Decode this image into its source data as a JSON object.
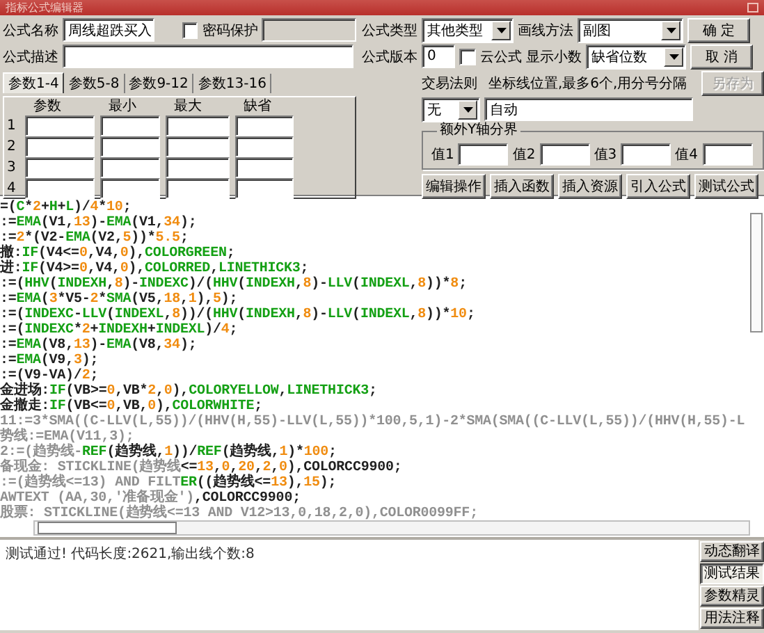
{
  "window": {
    "title": "指标公式编辑器"
  },
  "formula": {
    "name_label": "公式名称",
    "name": "周线超跌买入",
    "password": {
      "label": "密码保护",
      "checked": false
    },
    "desc_label": "公式描述",
    "type_label": "公式类型",
    "type": "其他类型",
    "draw_label": "画线方法",
    "draw": "副图",
    "version_label": "公式版本",
    "version": "0",
    "cloud": {
      "label": "云公式",
      "checked": false
    },
    "decimals_label": "显示小数",
    "decimals": "缺省位数"
  },
  "dialog_buttons": [
    {
      "label": "确 定",
      "disabled": false
    },
    {
      "label": "取 消",
      "disabled": false
    },
    {
      "label": "另存为",
      "disabled": true
    }
  ],
  "param_tabs": [
    {
      "label": "参数1-4",
      "selected": true
    },
    {
      "label": "参数5-8",
      "selected": false
    },
    {
      "label": "参数9-12",
      "selected": false
    },
    {
      "label": "参数13-16",
      "selected": false
    }
  ],
  "param_table": {
    "columns": [
      "参数",
      "最小",
      "最大",
      "缺省"
    ],
    "rows": [
      "1",
      "2",
      "3",
      "4"
    ]
  },
  "trade_rule": {
    "label": "交易法则",
    "value": "无"
  },
  "axis": {
    "label": "坐标线位置,最多6个,用分号分隔",
    "value": "自动"
  },
  "y_axis_group": {
    "title": "额外Y轴分界",
    "fields": [
      "值1",
      "值2",
      "值3",
      "值4"
    ]
  },
  "tool_buttons": [
    "编辑操作",
    "插入函数",
    "插入资源",
    "引入公式",
    "测试公式"
  ],
  "code_lines": [
    [
      {
        "kind": "p",
        "text": "=("
      },
      {
        "kind": "f",
        "text": "C"
      },
      {
        "kind": "p",
        "text": "*"
      },
      {
        "kind": "n",
        "text": "2"
      },
      {
        "kind": "p",
        "text": "+"
      },
      {
        "kind": "f",
        "text": "H"
      },
      {
        "kind": "p",
        "text": "+"
      },
      {
        "kind": "f",
        "text": "L"
      },
      {
        "kind": "p",
        "text": ")/"
      },
      {
        "kind": "n",
        "text": "4"
      },
      {
        "kind": "p",
        "text": "*"
      },
      {
        "kind": "n",
        "text": "10"
      },
      {
        "kind": "p",
        "text": ";"
      }
    ],
    [
      {
        "kind": "p",
        "text": ":="
      },
      {
        "kind": "f",
        "text": "EMA"
      },
      {
        "kind": "p",
        "text": "(V1,"
      },
      {
        "kind": "n",
        "text": "13"
      },
      {
        "kind": "p",
        "text": ")-"
      },
      {
        "kind": "f",
        "text": "EMA"
      },
      {
        "kind": "p",
        "text": "(V1,"
      },
      {
        "kind": "n",
        "text": "34"
      },
      {
        "kind": "p",
        "text": ");"
      }
    ],
    [
      {
        "kind": "p",
        "text": ":="
      },
      {
        "kind": "n",
        "text": "2"
      },
      {
        "kind": "p",
        "text": "*(V2-"
      },
      {
        "kind": "f",
        "text": "EMA"
      },
      {
        "kind": "p",
        "text": "(V2,"
      },
      {
        "kind": "n",
        "text": "5"
      },
      {
        "kind": "p",
        "text": "))*"
      },
      {
        "kind": "n",
        "text": "5.5"
      },
      {
        "kind": "p",
        "text": ";"
      }
    ],
    [
      {
        "kind": "p",
        "text": "撤:"
      },
      {
        "kind": "f",
        "text": "IF"
      },
      {
        "kind": "p",
        "text": "(V4<="
      },
      {
        "kind": "n",
        "text": "0"
      },
      {
        "kind": "p",
        "text": ",V4,"
      },
      {
        "kind": "n",
        "text": "0"
      },
      {
        "kind": "p",
        "text": "),"
      },
      {
        "kind": "f",
        "text": "COLORGREEN"
      },
      {
        "kind": "p",
        "text": ";"
      }
    ],
    [
      {
        "kind": "p",
        "text": "进:"
      },
      {
        "kind": "f",
        "text": "IF"
      },
      {
        "kind": "p",
        "text": "(V4>="
      },
      {
        "kind": "n",
        "text": "0"
      },
      {
        "kind": "p",
        "text": ",V4,"
      },
      {
        "kind": "n",
        "text": "0"
      },
      {
        "kind": "p",
        "text": "),"
      },
      {
        "kind": "f",
        "text": "COLORRED"
      },
      {
        "kind": "p",
        "text": ","
      },
      {
        "kind": "f",
        "text": "LINETHICK3"
      },
      {
        "kind": "p",
        "text": ";"
      }
    ],
    [
      {
        "kind": "p",
        "text": ":=("
      },
      {
        "kind": "f",
        "text": "HHV"
      },
      {
        "kind": "p",
        "text": "("
      },
      {
        "kind": "f",
        "text": "INDEXH"
      },
      {
        "kind": "p",
        "text": ","
      },
      {
        "kind": "n",
        "text": "8"
      },
      {
        "kind": "p",
        "text": ")-"
      },
      {
        "kind": "f",
        "text": "INDEXC"
      },
      {
        "kind": "p",
        "text": ")/("
      },
      {
        "kind": "f",
        "text": "HHV"
      },
      {
        "kind": "p",
        "text": "("
      },
      {
        "kind": "f",
        "text": "INDEXH"
      },
      {
        "kind": "p",
        "text": ","
      },
      {
        "kind": "n",
        "text": "8"
      },
      {
        "kind": "p",
        "text": ")-"
      },
      {
        "kind": "f",
        "text": "LLV"
      },
      {
        "kind": "p",
        "text": "("
      },
      {
        "kind": "f",
        "text": "INDEXL"
      },
      {
        "kind": "p",
        "text": ","
      },
      {
        "kind": "n",
        "text": "8"
      },
      {
        "kind": "p",
        "text": "))*"
      },
      {
        "kind": "n",
        "text": "8"
      },
      {
        "kind": "p",
        "text": ";"
      }
    ],
    [
      {
        "kind": "p",
        "text": ":="
      },
      {
        "kind": "f",
        "text": "EMA"
      },
      {
        "kind": "p",
        "text": "("
      },
      {
        "kind": "n",
        "text": "3"
      },
      {
        "kind": "p",
        "text": "*V5-"
      },
      {
        "kind": "n",
        "text": "2"
      },
      {
        "kind": "p",
        "text": "*"
      },
      {
        "kind": "f",
        "text": "SMA"
      },
      {
        "kind": "p",
        "text": "(V5,"
      },
      {
        "kind": "n",
        "text": "18"
      },
      {
        "kind": "p",
        "text": ","
      },
      {
        "kind": "n",
        "text": "1"
      },
      {
        "kind": "p",
        "text": "),"
      },
      {
        "kind": "n",
        "text": "5"
      },
      {
        "kind": "p",
        "text": ");"
      }
    ],
    [
      {
        "kind": "p",
        "text": ":=("
      },
      {
        "kind": "f",
        "text": "INDEXC"
      },
      {
        "kind": "p",
        "text": "-"
      },
      {
        "kind": "f",
        "text": "LLV"
      },
      {
        "kind": "p",
        "text": "("
      },
      {
        "kind": "f",
        "text": "INDEXL"
      },
      {
        "kind": "p",
        "text": ","
      },
      {
        "kind": "n",
        "text": "8"
      },
      {
        "kind": "p",
        "text": "))/("
      },
      {
        "kind": "f",
        "text": "HHV"
      },
      {
        "kind": "p",
        "text": "("
      },
      {
        "kind": "f",
        "text": "INDEXH"
      },
      {
        "kind": "p",
        "text": ","
      },
      {
        "kind": "n",
        "text": "8"
      },
      {
        "kind": "p",
        "text": ")-"
      },
      {
        "kind": "f",
        "text": "LLV"
      },
      {
        "kind": "p",
        "text": "("
      },
      {
        "kind": "f",
        "text": "INDEXL"
      },
      {
        "kind": "p",
        "text": ","
      },
      {
        "kind": "n",
        "text": "8"
      },
      {
        "kind": "p",
        "text": "))*"
      },
      {
        "kind": "n",
        "text": "10"
      },
      {
        "kind": "p",
        "text": ";"
      }
    ],
    [
      {
        "kind": "p",
        "text": ":=("
      },
      {
        "kind": "f",
        "text": "INDEXC"
      },
      {
        "kind": "p",
        "text": "*"
      },
      {
        "kind": "n",
        "text": "2"
      },
      {
        "kind": "p",
        "text": "+"
      },
      {
        "kind": "f",
        "text": "INDEXH"
      },
      {
        "kind": "p",
        "text": "+"
      },
      {
        "kind": "f",
        "text": "INDEXL"
      },
      {
        "kind": "p",
        "text": ")/"
      },
      {
        "kind": "n",
        "text": "4"
      },
      {
        "kind": "p",
        "text": ";"
      }
    ],
    [
      {
        "kind": "p",
        "text": ":="
      },
      {
        "kind": "f",
        "text": "EMA"
      },
      {
        "kind": "p",
        "text": "(V8,"
      },
      {
        "kind": "n",
        "text": "13"
      },
      {
        "kind": "p",
        "text": ")-"
      },
      {
        "kind": "f",
        "text": "EMA"
      },
      {
        "kind": "p",
        "text": "(V8,"
      },
      {
        "kind": "n",
        "text": "34"
      },
      {
        "kind": "p",
        "text": ");"
      }
    ],
    [
      {
        "kind": "p",
        "text": ":="
      },
      {
        "kind": "f",
        "text": "EMA"
      },
      {
        "kind": "p",
        "text": "(V9,"
      },
      {
        "kind": "n",
        "text": "3"
      },
      {
        "kind": "p",
        "text": ");"
      }
    ],
    [
      {
        "kind": "p",
        "text": ":=(V9-VA)/"
      },
      {
        "kind": "n",
        "text": "2"
      },
      {
        "kind": "p",
        "text": ";"
      }
    ],
    [
      {
        "kind": "p",
        "text": "金进场:"
      },
      {
        "kind": "f",
        "text": "IF"
      },
      {
        "kind": "p",
        "text": "(VB>="
      },
      {
        "kind": "n",
        "text": "0"
      },
      {
        "kind": "p",
        "text": ",VB*"
      },
      {
        "kind": "n",
        "text": "2"
      },
      {
        "kind": "p",
        "text": ","
      },
      {
        "kind": "n",
        "text": "0"
      },
      {
        "kind": "p",
        "text": "),"
      },
      {
        "kind": "f",
        "text": "COLORYELLOW"
      },
      {
        "kind": "p",
        "text": ","
      },
      {
        "kind": "f",
        "text": "LINETHICK3"
      },
      {
        "kind": "p",
        "text": ";"
      }
    ],
    [
      {
        "kind": "p",
        "text": "金撤走:"
      },
      {
        "kind": "f",
        "text": "IF"
      },
      {
        "kind": "p",
        "text": "(VB<="
      },
      {
        "kind": "n",
        "text": "0"
      },
      {
        "kind": "p",
        "text": ",VB,"
      },
      {
        "kind": "n",
        "text": "0"
      },
      {
        "kind": "p",
        "text": "),"
      },
      {
        "kind": "f",
        "text": "COLORWHITE"
      },
      {
        "kind": "p",
        "text": ";"
      }
    ],
    [
      {
        "kind": "g",
        "text": "11:=3*SMA((C-LLV(L,55))/(HHV(H,55)-LLV(L,55))*100,5,1)-2*SMA(SMA((C-LLV(L,55))/(HHV(H,55)-L"
      }
    ],
    [
      {
        "kind": "g",
        "text": "势线:=EMA(V11,3);"
      }
    ],
    [
      {
        "kind": "g",
        "text": "2:=(趋势线-"
      },
      {
        "kind": "f",
        "text": "REF"
      },
      {
        "kind": "p",
        "text": "(趋势线,"
      },
      {
        "kind": "n",
        "text": "1"
      },
      {
        "kind": "p",
        "text": "))/"
      },
      {
        "kind": "f",
        "text": "REF"
      },
      {
        "kind": "p",
        "text": "(趋势线,"
      },
      {
        "kind": "n",
        "text": "1"
      },
      {
        "kind": "p",
        "text": ")*"
      },
      {
        "kind": "n",
        "text": "100"
      },
      {
        "kind": "p",
        "text": ";"
      }
    ],
    [
      {
        "kind": "g",
        "text": "备现金: STICKLINE(趋势线"
      },
      {
        "kind": "p",
        "text": "<="
      },
      {
        "kind": "n",
        "text": "13"
      },
      {
        "kind": "p",
        "text": ","
      },
      {
        "kind": "n",
        "text": "0"
      },
      {
        "kind": "p",
        "text": ","
      },
      {
        "kind": "n",
        "text": "20"
      },
      {
        "kind": "p",
        "text": ","
      },
      {
        "kind": "n",
        "text": "2"
      },
      {
        "kind": "p",
        "text": ","
      },
      {
        "kind": "n",
        "text": "0"
      },
      {
        "kind": "p",
        "text": "),COLORCC9900;"
      }
    ],
    [
      {
        "kind": "g",
        "text": ":=(趋势线<=13) AND FILT"
      },
      {
        "kind": "f",
        "text": "ER"
      },
      {
        "kind": "p",
        "text": "((趋势线<="
      },
      {
        "kind": "n",
        "text": "13"
      },
      {
        "kind": "p",
        "text": "),"
      },
      {
        "kind": "n",
        "text": "15"
      },
      {
        "kind": "p",
        "text": ");"
      }
    ],
    [
      {
        "kind": "g",
        "text": "AWTEXT (AA,30,'准备现金')"
      },
      {
        "kind": "p",
        "text": ",COLORCC9900;"
      }
    ],
    [
      {
        "kind": "g",
        "text": "股票: STICKLINE(趋势线<=13 AND V12>13,0,18,2,0),COLOR0099FF;"
      }
    ]
  ],
  "status": "测试通过! 代码长度:2621,输出线个数:8",
  "side_buttons": [
    {
      "label": "动态翻译",
      "selected": false
    },
    {
      "label": "测试结果",
      "selected": true
    },
    {
      "label": "参数精灵",
      "selected": false
    },
    {
      "label": "用法注释",
      "selected": false
    }
  ]
}
